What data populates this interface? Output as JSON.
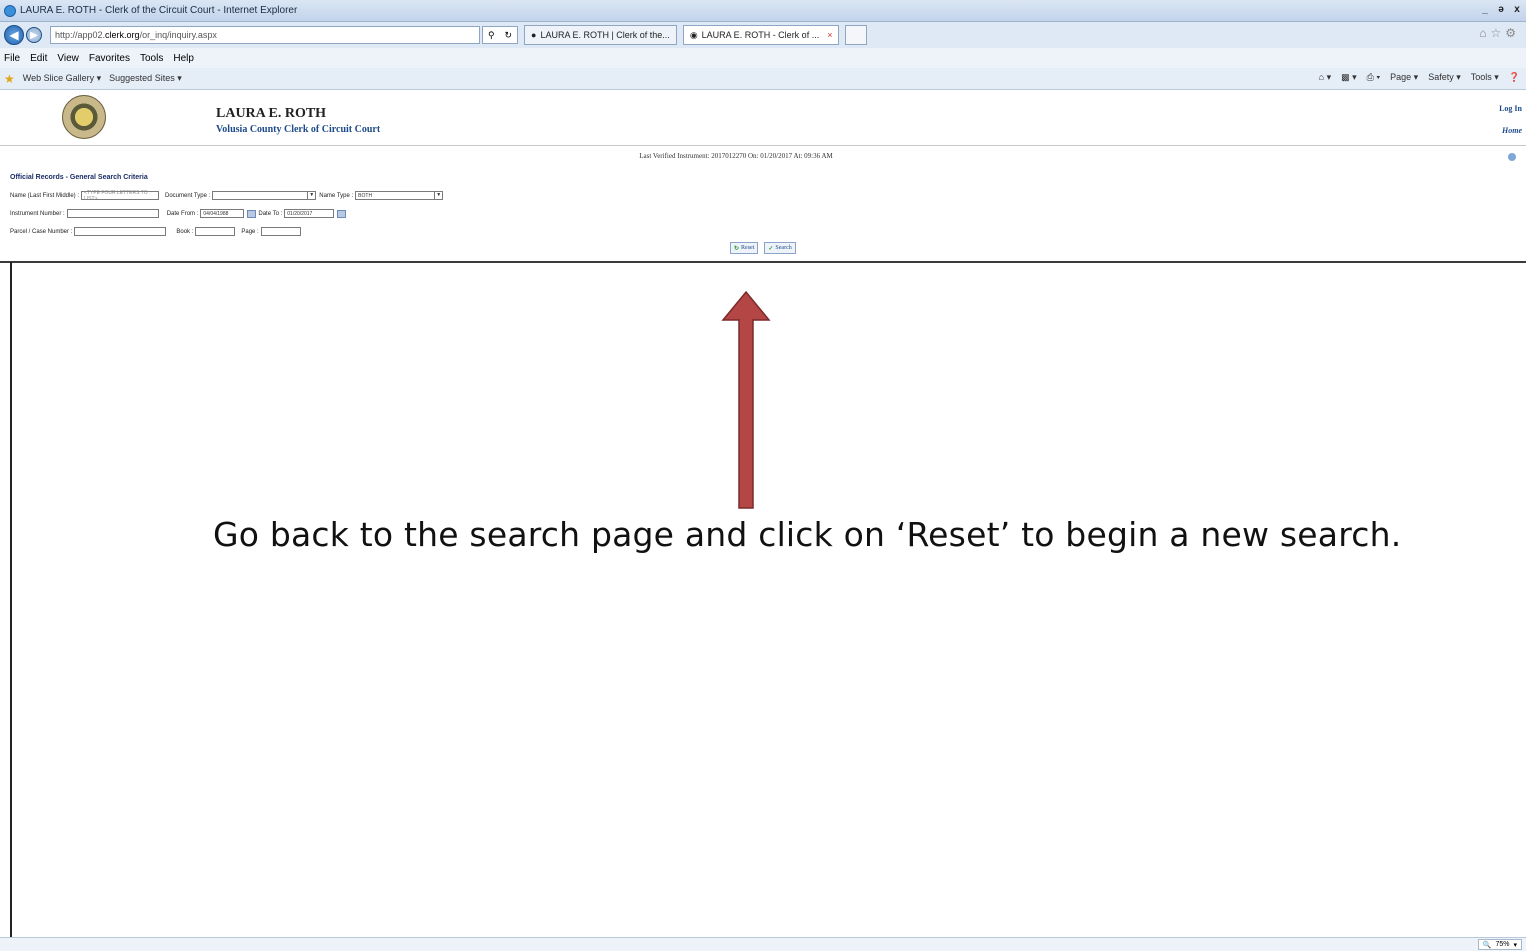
{
  "window": {
    "title": "LAURA E. ROTH - Clerk of the Circuit Court - Internet Explorer",
    "controls": [
      "_",
      "ə",
      "x"
    ]
  },
  "address": {
    "url_prefix": "http://app02.",
    "url_domain": "clerk.org",
    "url_path": "/or_inq/inquiry.aspx",
    "tabs": [
      {
        "label": "LAURA E. ROTH | Clerk of the..."
      },
      {
        "label": "LAURA E. ROTH - Clerk of ..."
      }
    ]
  },
  "menu": [
    "File",
    "Edit",
    "View",
    "Favorites",
    "Tools",
    "Help"
  ],
  "favorites": {
    "web_slice": "Web Slice Gallery ▾",
    "suggested": "Suggested Sites ▾",
    "right": [
      "Page ▾",
      "Safety ▾",
      "Tools ▾"
    ]
  },
  "site": {
    "name": "LAURA E. ROTH",
    "subtitle": "Volusia County Clerk of Circuit Court",
    "login": "Log In",
    "home": "Home"
  },
  "verified_text": "Last Verified Instrument: 2017012270 On: 01/20/2017 At: 09:36 AM",
  "search": {
    "title": "Official Records - General Search Criteria",
    "name_label": "Name (Last First Middle) :",
    "name_placeholder": "<TYPE FOUR LETTERS TO LIST>",
    "doc_type_label": "Document Type :",
    "doc_type_value": "",
    "name_type_label": "Name Type :",
    "name_type_value": "BOTH",
    "instrument_label": "Instrument Number :",
    "date_from_label": "Date From :",
    "date_from_value": "04/04/1988",
    "date_to_label": "Date To :",
    "date_to_value": "01/20/2017",
    "parcel_label": "Parcel / Case Number :",
    "book_label": "Book :",
    "page_label": "Page :",
    "reset_label": "Reset",
    "search_label": "Search"
  },
  "instruction": "Go back to the search page and click on ‘Reset’ to begin a new search.",
  "arrow_color": "#b54646",
  "statusbar": {
    "zoom": "75%"
  }
}
